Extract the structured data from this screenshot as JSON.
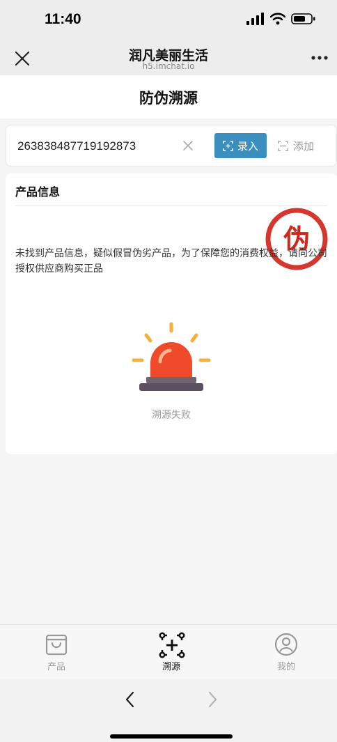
{
  "status_bar": {
    "time": "11:40"
  },
  "nav": {
    "title": "润凡美丽生活",
    "subtitle": "h5.imchat.io"
  },
  "page": {
    "title": "防伪溯源"
  },
  "search": {
    "code": "263838487719192873",
    "enter_label": "录入",
    "add_label": "添加"
  },
  "product_info": {
    "title": "产品信息",
    "stamp_text": "伪",
    "message": "未找到产品信息，疑似假冒伪劣产品，为了保障您的消费权益，请向公司授权供应商购买正品",
    "status_label": "溯源失败"
  },
  "tabs": [
    {
      "label": "产品",
      "icon": "shopping-bag-icon",
      "active": false
    },
    {
      "label": "溯源",
      "icon": "trace-icon",
      "active": true
    },
    {
      "label": "我的",
      "icon": "user-icon",
      "active": false
    }
  ],
  "colors": {
    "accent": "#3b8fbf",
    "stamp": "#d0261c",
    "alarm": "#ef4a2a"
  }
}
